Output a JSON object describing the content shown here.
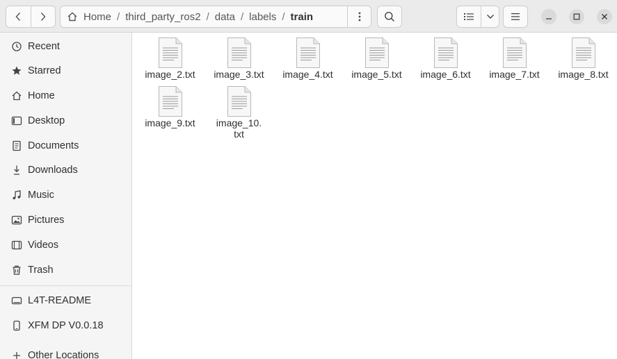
{
  "path": {
    "segments": [
      "Home",
      "third_party_ros2",
      "data",
      "labels",
      "train"
    ]
  },
  "sidebar": {
    "items": [
      {
        "label": "Recent",
        "icon": "clock-icon"
      },
      {
        "label": "Starred",
        "icon": "star-icon"
      },
      {
        "label": "Home",
        "icon": "home-icon"
      },
      {
        "label": "Desktop",
        "icon": "desktop-icon"
      },
      {
        "label": "Documents",
        "icon": "document-icon"
      },
      {
        "label": "Downloads",
        "icon": "download-icon"
      },
      {
        "label": "Music",
        "icon": "music-icon"
      },
      {
        "label": "Pictures",
        "icon": "picture-icon"
      },
      {
        "label": "Videos",
        "icon": "video-icon"
      },
      {
        "label": "Trash",
        "icon": "trash-icon"
      }
    ],
    "devices": [
      {
        "label": "L4T-README",
        "icon": "drive-icon"
      },
      {
        "label": "XFM DP V0.0.18",
        "icon": "phone-icon"
      },
      {
        "label": "Other Locations",
        "icon": "plus-icon"
      }
    ]
  },
  "files": [
    {
      "name": "image_2.txt"
    },
    {
      "name": "image_3.txt"
    },
    {
      "name": "image_4.txt"
    },
    {
      "name": "image_5.txt"
    },
    {
      "name": "image_6.txt"
    },
    {
      "name": "image_7.txt"
    },
    {
      "name": "image_8.txt"
    },
    {
      "name": "image_9.txt"
    },
    {
      "name": "image_10.\ntxt"
    }
  ]
}
